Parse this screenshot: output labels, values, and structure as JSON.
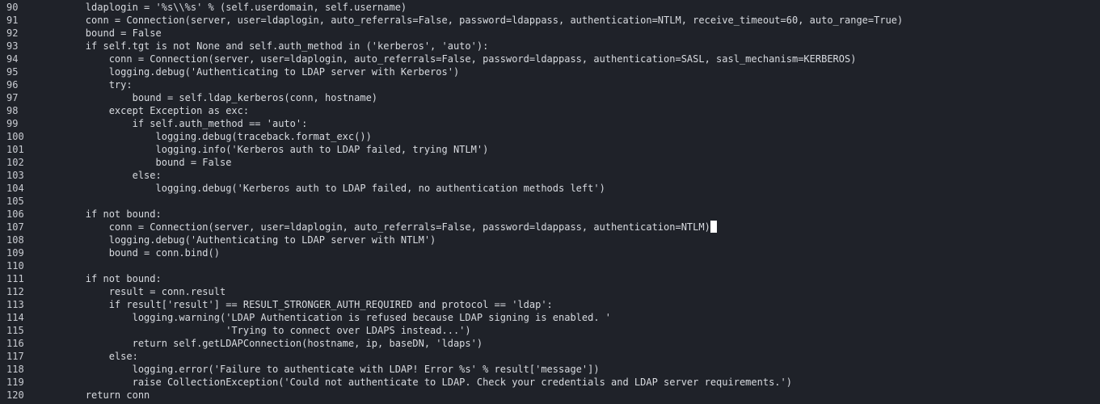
{
  "editor": {
    "cursor_line": 107,
    "lines": [
      {
        "n": "90",
        "t": "        ldaplogin = '%s\\\\%s' % (self.userdomain, self.username)"
      },
      {
        "n": "91",
        "t": "        conn = Connection(server, user=ldaplogin, auto_referrals=False, password=ldappass, authentication=NTLM, receive_timeout=60, auto_range=True)"
      },
      {
        "n": "92",
        "t": "        bound = False"
      },
      {
        "n": "93",
        "t": "        if self.tgt is not None and self.auth_method in ('kerberos', 'auto'):"
      },
      {
        "n": "94",
        "t": "            conn = Connection(server, user=ldaplogin, auto_referrals=False, password=ldappass, authentication=SASL, sasl_mechanism=KERBEROS)"
      },
      {
        "n": "95",
        "t": "            logging.debug('Authenticating to LDAP server with Kerberos')"
      },
      {
        "n": "96",
        "t": "            try:"
      },
      {
        "n": "97",
        "t": "                bound = self.ldap_kerberos(conn, hostname)"
      },
      {
        "n": "98",
        "t": "            except Exception as exc:"
      },
      {
        "n": "99",
        "t": "                if self.auth_method == 'auto':"
      },
      {
        "n": "100",
        "t": "                    logging.debug(traceback.format_exc())"
      },
      {
        "n": "101",
        "t": "                    logging.info('Kerberos auth to LDAP failed, trying NTLM')"
      },
      {
        "n": "102",
        "t": "                    bound = False"
      },
      {
        "n": "103",
        "t": "                else:"
      },
      {
        "n": "104",
        "t": "                    logging.debug('Kerberos auth to LDAP failed, no authentication methods left')"
      },
      {
        "n": "105",
        "t": ""
      },
      {
        "n": "106",
        "t": "        if not bound:"
      },
      {
        "n": "107",
        "t": "            conn = Connection(server, user=ldaplogin, auto_referrals=False, password=ldappass, authentication=NTLM)"
      },
      {
        "n": "108",
        "t": "            logging.debug('Authenticating to LDAP server with NTLM')"
      },
      {
        "n": "109",
        "t": "            bound = conn.bind()"
      },
      {
        "n": "110",
        "t": ""
      },
      {
        "n": "111",
        "t": "        if not bound:"
      },
      {
        "n": "112",
        "t": "            result = conn.result"
      },
      {
        "n": "113",
        "t": "            if result['result'] == RESULT_STRONGER_AUTH_REQUIRED and protocol == 'ldap':"
      },
      {
        "n": "114",
        "t": "                logging.warning('LDAP Authentication is refused because LDAP signing is enabled. '"
      },
      {
        "n": "115",
        "t": "                                'Trying to connect over LDAPS instead...')"
      },
      {
        "n": "116",
        "t": "                return self.getLDAPConnection(hostname, ip, baseDN, 'ldaps')"
      },
      {
        "n": "117",
        "t": "            else:"
      },
      {
        "n": "118",
        "t": "                logging.error('Failure to authenticate with LDAP! Error %s' % result['message'])"
      },
      {
        "n": "119",
        "t": "                raise CollectionException('Could not authenticate to LDAP. Check your credentials and LDAP server requirements.')"
      },
      {
        "n": "120",
        "t": "        return conn"
      }
    ]
  }
}
